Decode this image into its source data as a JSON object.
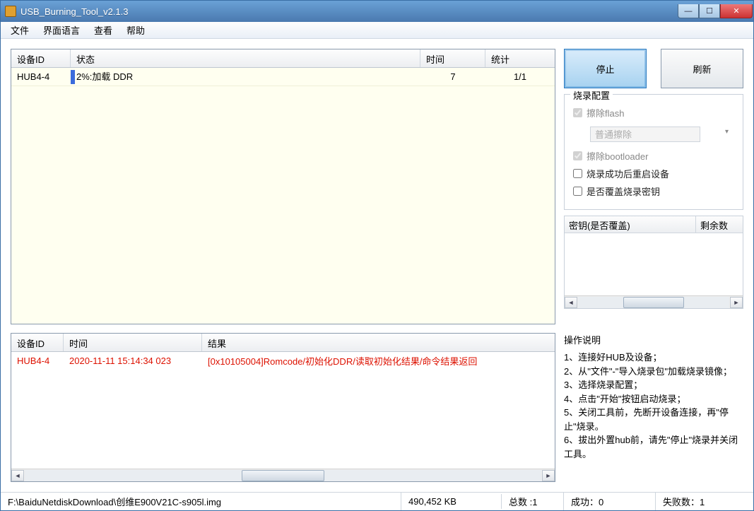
{
  "window": {
    "title": "USB_Burning_Tool_v2.1.3"
  },
  "menu": {
    "file": "文件",
    "lang": "界面语言",
    "view": "查看",
    "help": "帮助"
  },
  "devtable": {
    "headers": {
      "devid": "设备ID",
      "status": "状态",
      "time": "时间",
      "stat": "统计"
    },
    "rows": [
      {
        "devid": "HUB4-4",
        "status": "2%:加载 DDR",
        "time": "7",
        "stat": "1/1"
      }
    ]
  },
  "buttons": {
    "stop": "停止",
    "refresh": "刷新"
  },
  "burncfg": {
    "title": "烧录配置",
    "erase_flash": "擦除flash",
    "erase_mode": "普通擦除",
    "erase_bootloader": "擦除bootloader",
    "reboot_after": "烧录成功后重启设备",
    "overwrite_key": "是否覆盖烧录密钥"
  },
  "keytable": {
    "h1": "密钥(是否覆盖)",
    "h2": "剩余数"
  },
  "log": {
    "headers": {
      "devid": "设备ID",
      "time": "时间",
      "result": "结果"
    },
    "rows": [
      {
        "devid": "HUB4-4",
        "time": "2020-11-11 15:14:34 023",
        "result": "[0x10105004]Romcode/初始化DDR/读取初始化结果/命令结果返回"
      }
    ]
  },
  "instructions": {
    "title": "操作说明",
    "body": "1、连接好HUB及设备；\n2、从\"文件\"-\"导入烧录包\"加载烧录镜像；\n3、选择烧录配置；\n4、点击\"开始\"按钮启动烧录；\n5、关闭工具前，先断开设备连接，再\"停止\"烧录。\n6、拔出外置hub前，请先\"停止\"烧录并关闭工具。"
  },
  "status": {
    "path": "F:\\BaiduNetdiskDownload\\创维E900V21C-s905l.img",
    "size": "490,452 KB",
    "total_label": "总数 :",
    "total": "1",
    "succ_label": "成功：",
    "succ": "0",
    "fail_label": "失败数：",
    "fail": "1"
  }
}
